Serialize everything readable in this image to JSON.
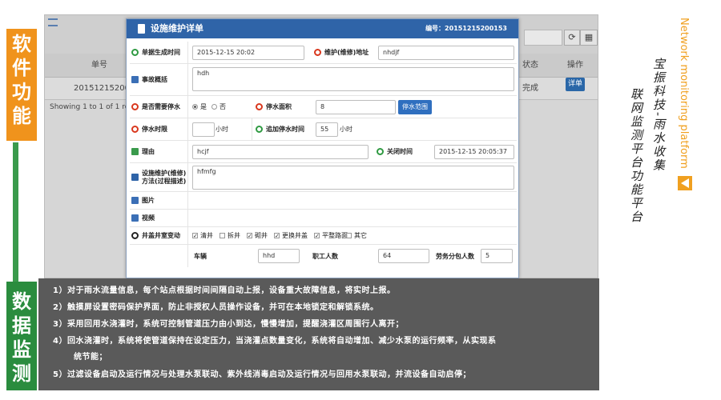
{
  "side_labels": {
    "top": [
      "软",
      "件",
      "功",
      "能"
    ],
    "bottom": [
      "数",
      "据",
      "监",
      "测"
    ]
  },
  "branding": {
    "english": "Network monitoring platform",
    "calligraphy_line1": "宝振科技-雨水收集",
    "calligraphy_line2": "联网监测平台功能平台",
    "accent_color": "#f0a020"
  },
  "background_table": {
    "headers": [
      "单号",
      "状态",
      "操作"
    ],
    "row": {
      "id": "20151215200153",
      "status": "完成",
      "action": "详单"
    },
    "showing": "Showing 1 to 1 of 1 rows",
    "toolbar_icons": [
      "refresh-icon",
      "grid-icon"
    ]
  },
  "modal": {
    "title": "设施维护详单",
    "number_label": "编号：20151215200153",
    "fields": {
      "created_label": "单据生成时间",
      "created_value": "2015-12-15 20:02",
      "address_label": "维护(维修)地址",
      "address_value": "nhdjf",
      "summary_label": "事故概括",
      "summary_value": "hdh",
      "stop_water_label": "是否需要停水",
      "stop_yes": "是",
      "stop_no": "否",
      "stop_yes_selected": true,
      "stop_area_label": "停水面积",
      "stop_area_value": "8",
      "stop_range_button": "停水范围",
      "stop_limit_label": "停水时限",
      "stop_limit_value": "",
      "hour_unit": "小时",
      "extra_time_label": "追加停水时间",
      "extra_time_value": "55",
      "reason_label": "理由",
      "reason_value": "hcjf",
      "close_time_label": "关闭时间",
      "close_time_value": "2015-12-15 20:05:37",
      "method_label_1": "设施维护(维修)",
      "method_label_2": "方法(过程描述)",
      "method_value": "hfmfg",
      "image_label": "图片",
      "video_label": "视频",
      "well_label": "井盖井室变动",
      "well_options": [
        {
          "label": "清井",
          "checked": true
        },
        {
          "label": "拆井",
          "checked": false
        },
        {
          "label": "砌井",
          "checked": true
        },
        {
          "label": "更换井盖",
          "checked": true
        },
        {
          "label": "平整路面",
          "checked": true
        },
        {
          "label": "其它",
          "checked": false
        }
      ],
      "vehicle_label": "车辆",
      "vehicle_value": "hhd",
      "workers_label": "职工人数",
      "workers_value": "64",
      "contract_label": "劳务分包人数",
      "contract_value": "5"
    }
  },
  "notes": [
    "1）对于雨水流量信息，每个站点根据时间间隔自动上报，设备重大故障信息，将实时上报。",
    "2）触摸屏设置密码保护界面，防止非授权人员操作设备，并可在本地锁定和解锁系统。",
    "3）采用回用水浇灌时，系统可控制管道压力由小到达，慢慢增加，提醒浇灌区周围行人离开；",
    "4）回水浇灌时，系统将使管道保持在设定压力，当浇灌点数量变化，系统将自动增加、减少水泵的运行频率，从实现系",
    "统节能；",
    "5）过滤设备启动及运行情况与处理水泵联动、紫外线消毒启动及运行情况与回用水泵联动，并流设备自动启停；"
  ]
}
